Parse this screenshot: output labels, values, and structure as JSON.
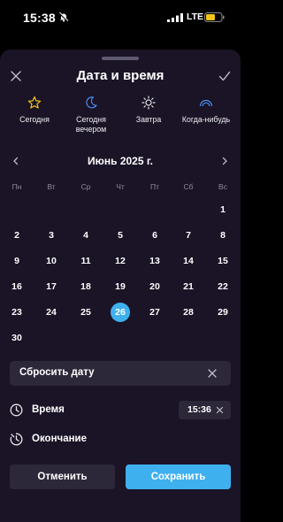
{
  "status_bar": {
    "time": "15:38",
    "network": "LTE",
    "icons": [
      "bell-off-icon",
      "signal-icon",
      "battery-icon"
    ],
    "battery_color": "#f5c518"
  },
  "sheet": {
    "title": "Дата и время",
    "close_icon": "close-icon",
    "confirm_icon": "check-icon",
    "accent_color": "#3fb0ee"
  },
  "quick_options": [
    {
      "label": "Сегодня",
      "icon": "star-icon",
      "color": "#f5c518"
    },
    {
      "label": "Сегодня\nвечером",
      "icon": "moon-icon",
      "color": "#4a8df0"
    },
    {
      "label": "Завтра",
      "icon": "sun-icon",
      "color": "#e6e6ea"
    },
    {
      "label": "Когда-нибудь",
      "icon": "rainbow-icon",
      "color": "#4a8df0"
    }
  ],
  "calendar": {
    "month_title": "Июнь 2025 г.",
    "weekdays": [
      "Пн",
      "Вт",
      "Ср",
      "Чт",
      "Пт",
      "Сб",
      "Вс"
    ],
    "first_weekday_index": 6,
    "days_in_month": 30,
    "selected_day": 26
  },
  "reset": {
    "label": "Сбросить дату"
  },
  "time_row": {
    "label": "Время",
    "value": "15:36"
  },
  "end_row": {
    "label": "Окончание"
  },
  "buttons": {
    "cancel": "Отменить",
    "save": "Сохранить"
  }
}
